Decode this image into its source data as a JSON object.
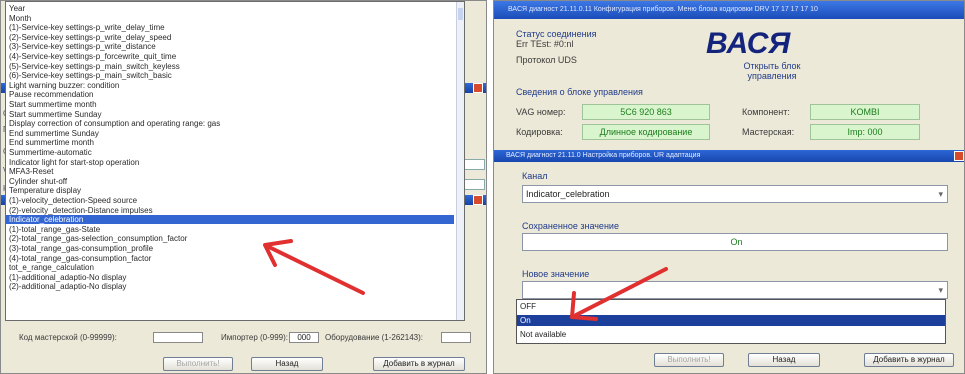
{
  "left": {
    "dropdown_items": [
      "Year",
      "Month",
      "(1)-Service-key settings-p_write_delay_time",
      "(2)-Service-key settings-p_write_delay_speed",
      "(3)-Service-key settings-p_write_distance",
      "(4)-Service-key settings-p_forcewrite_quit_time",
      "(5)-Service-key settings-p_main_switch_keyless",
      "(6)-Service-key settings-p_main_switch_basic",
      "Light warning buzzer: condition",
      "Pause recommendation",
      "Start summertime month",
      "Start summertime Sunday",
      "Display correction of consumption and operating range: gas",
      "End summertime Sunday",
      "End summertime month",
      "Summertime-automatic",
      "Indicator light for start-stop operation",
      "MFA3-Reset",
      "Cylinder shut-off",
      "Temperature display",
      "(1)-velocity_detection-Speed source",
      "(2)-velocity_detection-Distance impulses",
      "Indicator_celebration",
      "(1)-total_range_gas-State",
      "(2)-total_range_gas-selection_consumption_factor",
      "(3)-total_range_gas-consumption_profile",
      "(4)-total_range_gas-consumption_factor",
      "tot_e_range_calculation",
      "(1)-additional_adaptio-No display",
      "(2)-additional_adaptio-No display"
    ],
    "selected_index": 22,
    "workshop_code_label": "Код мастерской (0-99999):",
    "workshop_code_value": "",
    "importer_label": "Импортер (0-999):",
    "importer_value": "000",
    "equipment_label": "Оборудование (1-262143):",
    "equipment_value": "",
    "execute_button": "Выполнить!",
    "back_button": "Назад",
    "add_log_button": "Добавить в журнал"
  },
  "right": {
    "window_title": "ВАСЯ диагност 21.11.0.11 Конфигурация приборов. Меню блока кодировки DRV 17 17 17 17 10",
    "connection_status_label": "Статус соединения",
    "connection_status_value": "Err TEst: #0:nl",
    "protocol_label": "Протокол UDS",
    "brand": "ВАСЯ",
    "open_block_label": "Открыть блок управления",
    "block_info_label": "Сведения о блоке управления",
    "vag_number_label": "VAG номер:",
    "vag_number_value": "5C6 920 863",
    "component_label": "Компонент:",
    "component_value": "KOMBI",
    "coding_label": "Кодировка:",
    "coding_value": "Длинное кодирование",
    "workshop_label": "Мастерская:",
    "workshop_value": "Imp: 000",
    "sub_window_title": "ВАСЯ диагност 21.11.0 Настройка приборов. UR адаптация",
    "channel_label": "Канал",
    "channel_value": "Indicator_celebration",
    "stored_value_label": "Сохраненное значение",
    "stored_value": "On",
    "new_value_label": "Новое значение",
    "options": [
      "OFF",
      "On",
      "Not available"
    ],
    "selected_option": "On",
    "execute_button": "Выполнить!",
    "back_button": "Назад",
    "add_log_button": "Добавить в журнал"
  },
  "colors": {
    "selection": "#3466d1",
    "title_bar": "#1a4cb8",
    "green_field": "#d8f5cd",
    "arrow": "#e03030"
  }
}
